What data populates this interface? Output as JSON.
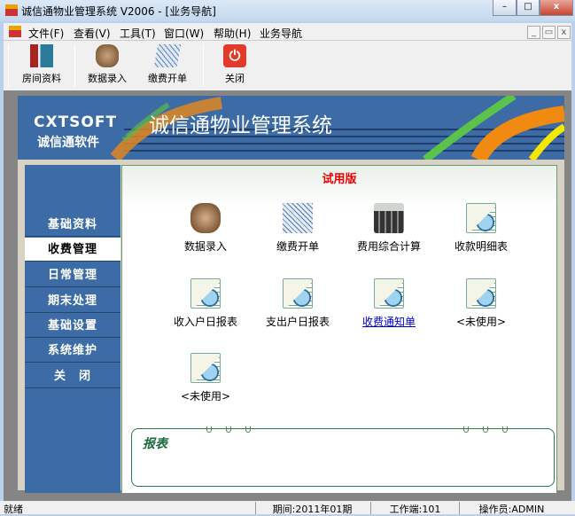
{
  "window": {
    "title": "诚信通物业管理系统 V2006 - [业务导航]",
    "minimize": "–",
    "maximize": "□",
    "close": "x"
  },
  "menu": {
    "items": [
      "文件(F)",
      "查看(V)",
      "工具(T)",
      "窗口(W)",
      "帮助(H)",
      "业务导航"
    ],
    "mdi": [
      "_",
      "▭",
      "x"
    ]
  },
  "toolbar": {
    "items": [
      "房间资料",
      "数据录入",
      "缴费开单",
      "关闭"
    ]
  },
  "banner": {
    "brand": "CXTSOFT",
    "brand_cn": "诚信通软件",
    "title": "诚信通物业管理系统"
  },
  "sidebar": {
    "items": [
      "基础资料",
      "收费管理",
      "日常管理",
      "期末处理",
      "基础设置",
      "系统维护",
      "关　闭"
    ],
    "selected": 1
  },
  "content": {
    "trial": "试用版",
    "items": [
      "数据录入",
      "缴费开单",
      "费用综合计算",
      "收款明细表",
      "收入户日报表",
      "支出户日报表",
      "收费通知单",
      "<未使用>",
      "<未使用>"
    ],
    "report_title": "报表"
  },
  "status": {
    "ready": "就绪",
    "period": "期间:2011年01期",
    "terminal": "工作端:101",
    "operator": "操作员:ADMIN"
  },
  "colors": {
    "sidebar": "#3c6ba5",
    "trial": "#e00000",
    "report": "#1a6a3a"
  }
}
